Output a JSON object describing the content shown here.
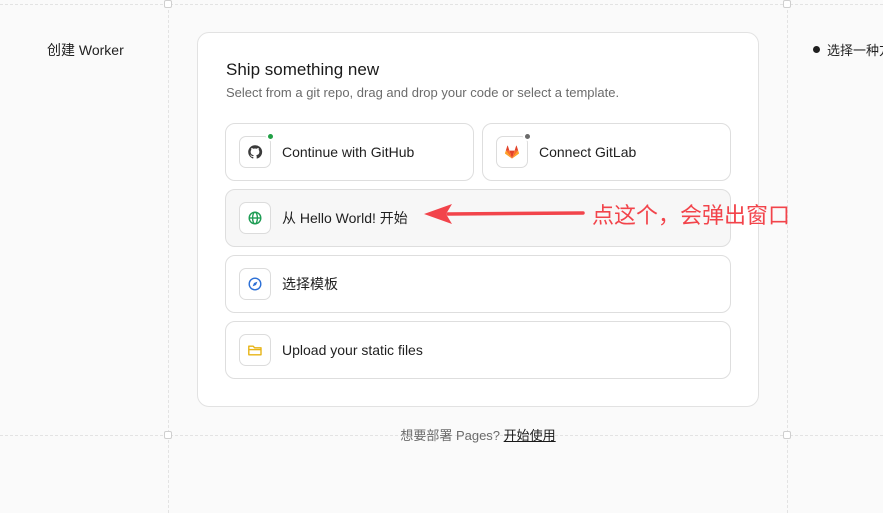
{
  "left_panel": {
    "title": "创建 Worker"
  },
  "right_panel": {
    "step_label": "选择一种方"
  },
  "card": {
    "title": "Ship something new",
    "subtitle": "Select from a git repo, drag and drop your code or select a template.",
    "options": {
      "github": {
        "label": "Continue with GitHub",
        "icon": "github-icon",
        "status_color": "#22a046"
      },
      "gitlab": {
        "label": "Connect GitLab",
        "icon": "gitlab-icon",
        "status_color": "#6b6b6b"
      },
      "hello_world": {
        "label": "从 Hello World! 开始",
        "icon": "globe-icon"
      },
      "template": {
        "label": "选择模板",
        "icon": "compass-icon"
      },
      "upload": {
        "label": "Upload your static files",
        "icon": "folder-icon"
      }
    }
  },
  "footer": {
    "prefix": "想要部署 Pages?",
    "link": "开始使用"
  },
  "annotation": {
    "text": "点这个，会弹出窗口",
    "color": "#f2444b"
  },
  "colors": {
    "github_icon": "#3b3b3b",
    "gitlab_icon": "#e2432a",
    "globe_icon": "#1f9d55",
    "compass_icon": "#2b6fd6",
    "folder_icon": "#e7b416"
  }
}
